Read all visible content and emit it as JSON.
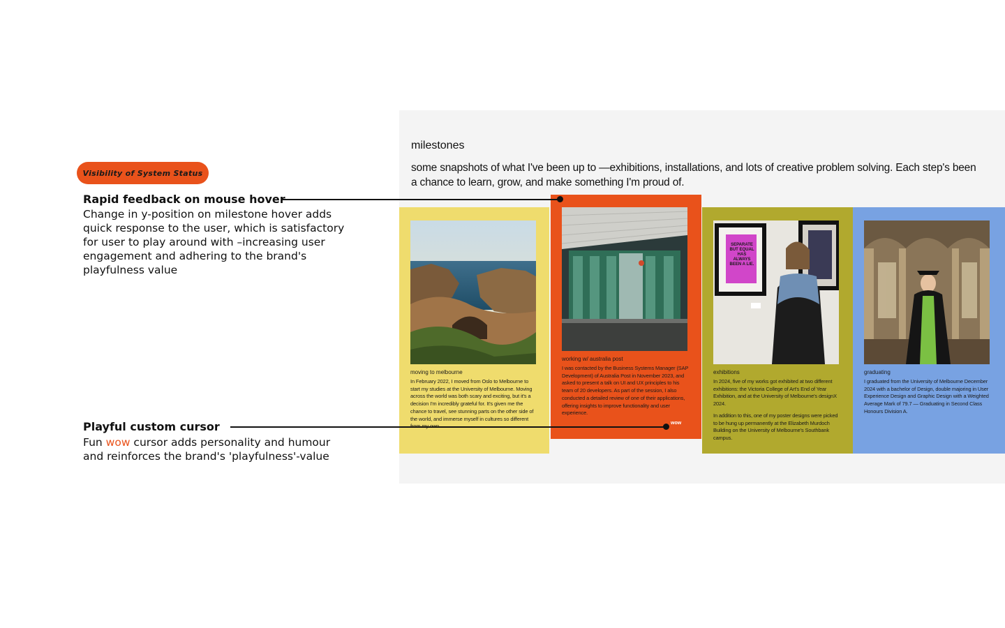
{
  "annotation": {
    "badge": "Visibility of System Status",
    "hover_note": {
      "title": "Rapid feedback on mouse hover",
      "body": "Change in y-position on milestone hover adds quick response to the user, which is satisfactory for user to play around with –increasing user engagement and adhering to the brand's playfulness value"
    },
    "cursor_note": {
      "title": "Playful custom cursor",
      "body_before": "Fun ",
      "body_accent": "wow",
      "body_after": " cursor adds personality and humour and reinforces the brand's 'playfulness'-value"
    }
  },
  "milestones": {
    "heading": "milestones",
    "intro": "some snapshots of what I've been up to —exhibitions, installations, and lots of creative problem solving. Each step's been a chance to learn, grow, and make something I'm proud of.",
    "cursor_label": "wow",
    "cards": [
      {
        "label": "moving to melbourne",
        "paragraphs": [
          "In February 2022, I moved from Oslo to Melbourne to start my studies at the University of Melbourne. Moving across the world was both scary and exciting, but it's a decision I'm incredibly grateful for. It's given me the chance to travel, see stunning parts on the other side of the world, and immerse myself in cultures so different from my own."
        ]
      },
      {
        "label": "working w/ australia post",
        "paragraphs": [
          "I was contacted by the Business Systems Manager (SAP Development) of Australia Post in November 2023, and asked to present a talk on UI and UX principles to his team of 20 developers. As part of the session, I also conducted a detailed review of one of their applications, offering insights to improve functionality and user experience."
        ]
      },
      {
        "label": "exhibitions",
        "poster_text": "SEPARATE BUT EQUAL HAS ALWAYS BEEN A LIE.",
        "paragraphs": [
          "In 2024, five of my works got exhibited at two different exhibitions: the Victoria College of Art's End of Year Exhibition, and at the University of Melbourne's designX 2024.",
          "In addition to this, one of my poster designs were picked to be hung up permanently at the Elizabeth Murdoch Building on the University of Melbourne's Southbank campus."
        ]
      },
      {
        "label": "graduating",
        "paragraphs": [
          "I graduated from the University of Melbourne December 2024 with a bachelor of Design, double majoring in User Experience Design and Graphic Design with a Weighted Average Mark of 79.7 — Graduating in Second Class Honours Division A."
        ]
      }
    ]
  }
}
